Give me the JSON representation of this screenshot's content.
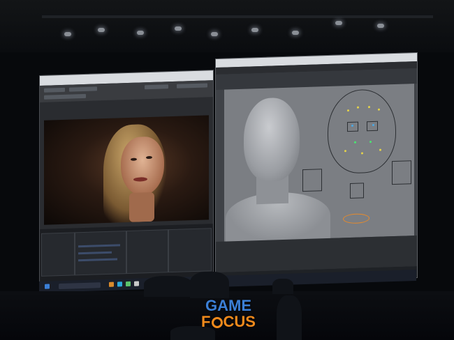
{
  "scene": "stage-presentation-photo",
  "watermark": {
    "line1": "GAME",
    "line2_pre": "F",
    "line2_post": "CUS"
  },
  "colors": {
    "logo_blue": "#3b7fd6",
    "logo_orange": "#f08a1c",
    "screen_bg": "#2a2c30",
    "viewport_bg": "#7b7e83"
  }
}
